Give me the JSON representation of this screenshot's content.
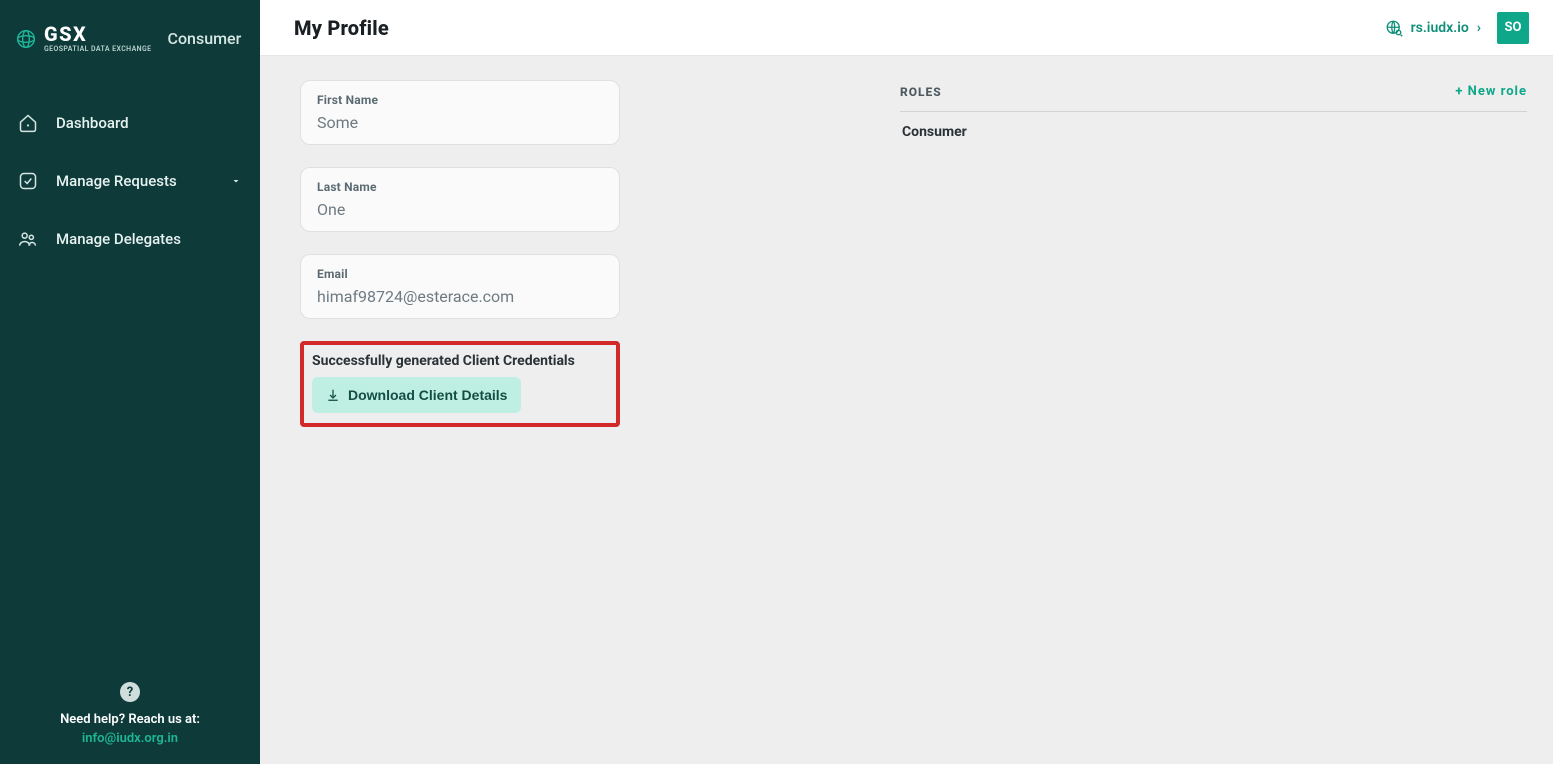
{
  "brand": {
    "name": "GSX",
    "subtitle": "GEOSPATIAL DATA EXCHANGE",
    "role": "Consumer"
  },
  "sidebar": {
    "items": [
      {
        "label": "Dashboard"
      },
      {
        "label": "Manage Requests"
      },
      {
        "label": "Manage Delegates"
      }
    ]
  },
  "help": {
    "label": "Need help? Reach us at:",
    "email": "info@iudx.org.in"
  },
  "header": {
    "title": "My Profile",
    "rs_link": "rs.iudx.io",
    "avatar_initials": "SO"
  },
  "profile": {
    "first_name_label": "First Name",
    "first_name_value": "Some",
    "last_name_label": "Last Name",
    "last_name_value": "One",
    "email_label": "Email",
    "email_value": "himaf98724@esterace.com"
  },
  "credentials": {
    "status": "Successfully generated Client Credentials",
    "download_label": "Download Client Details"
  },
  "roles": {
    "header": "ROLES",
    "new_role_label": "+ New role",
    "items": [
      {
        "name": "Consumer"
      }
    ]
  }
}
